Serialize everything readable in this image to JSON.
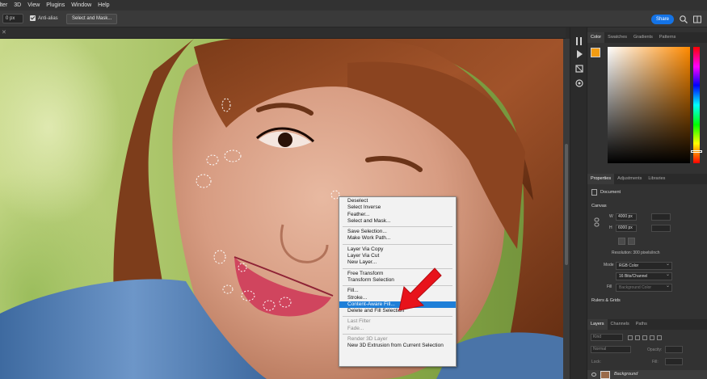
{
  "menubar": {
    "items": [
      "ilter",
      "3D",
      "View",
      "Plugins",
      "Window",
      "Help"
    ]
  },
  "options": {
    "feather_value": "0 px",
    "anti_alias_label": "Anti-alias",
    "anti_alias_checked": true,
    "select_mask_label": "Select and Mask...",
    "share_label": "Share"
  },
  "panels": {
    "color_tabs": [
      "Color",
      "Swatches",
      "Gradients",
      "Patterns"
    ],
    "foreground_color": "#f39c12",
    "properties_tabs": [
      "Properties",
      "Adjustments",
      "Libraries"
    ],
    "document_label": "Document",
    "canvas_heading": "Canvas",
    "width_label": "W",
    "width_value": "4000 px",
    "height_label": "H",
    "height_value": "6000 px",
    "resolution": "Resolution: 300 pixels/inch",
    "mode_label": "Mode",
    "mode_value": "RGB Color",
    "depth_value": "16 Bits/Channel",
    "fill_label": "Fill",
    "fill_value": "Background Color",
    "rulers_heading": "Rulers & Grids",
    "layers_tabs": [
      "Layers",
      "Channels",
      "Paths"
    ],
    "layers_kind": "Kind",
    "layers_blend": "Normal",
    "opacity_label": "Opacity:",
    "lock_label": "Lock:",
    "fill_layer_label": "Fill:",
    "background_layer": "Background"
  },
  "context_menu": {
    "groups": [
      [
        {
          "label": "Deselect",
          "disabled": false
        },
        {
          "label": "Select Inverse",
          "disabled": false
        },
        {
          "label": "Feather...",
          "disabled": false
        },
        {
          "label": "Select and Mask...",
          "disabled": false
        }
      ],
      [
        {
          "label": "Save Selection...",
          "disabled": false
        },
        {
          "label": "Make Work Path...",
          "disabled": false
        }
      ],
      [
        {
          "label": "Layer Via Copy",
          "disabled": false
        },
        {
          "label": "Layer Via Cut",
          "disabled": false
        },
        {
          "label": "New Layer...",
          "disabled": false
        }
      ],
      [
        {
          "label": "Free Transform",
          "disabled": false
        },
        {
          "label": "Transform Selection",
          "disabled": false
        }
      ],
      [
        {
          "label": "Fill...",
          "disabled": false
        },
        {
          "label": "Stroke...",
          "disabled": false
        },
        {
          "label": "Content-Aware Fill...",
          "disabled": false,
          "highlighted": true
        },
        {
          "label": "Delete and Fill Selection",
          "disabled": false
        }
      ],
      [
        {
          "label": "Last Filter",
          "disabled": true
        },
        {
          "label": "Fade...",
          "disabled": true
        }
      ],
      [
        {
          "label": "Render 3D Layer",
          "disabled": true
        },
        {
          "label": "New 3D Extrusion from Current Selection",
          "disabled": false
        }
      ]
    ]
  },
  "annotation": {
    "arrow_color": "#e8131b"
  }
}
